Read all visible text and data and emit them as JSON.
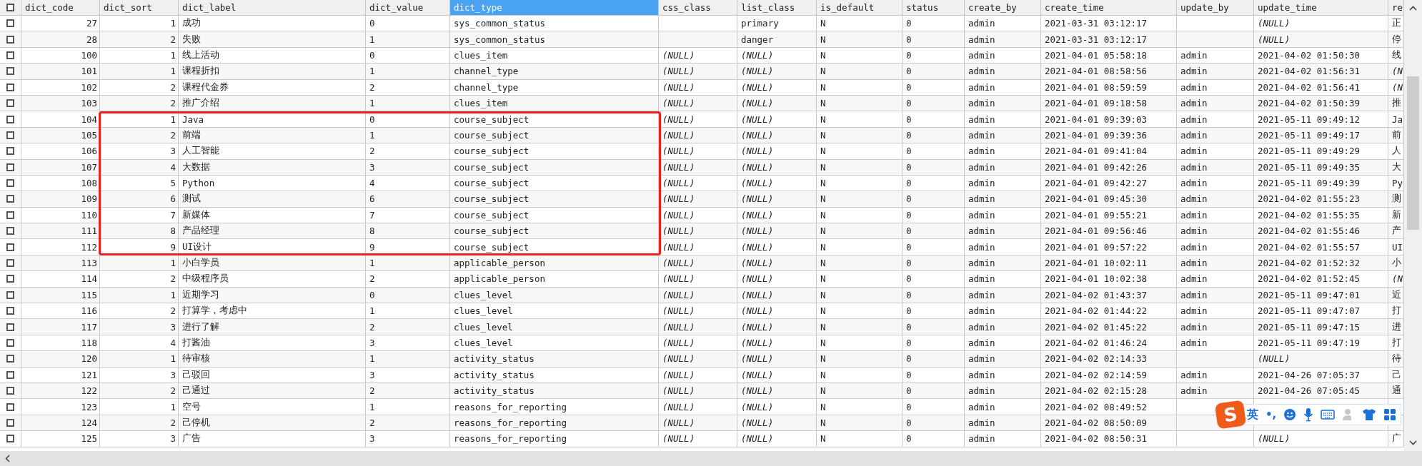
{
  "header_checkbox": {
    "checked": false
  },
  "columns": [
    {
      "label": "dict_code",
      "selected": false,
      "kind": "number"
    },
    {
      "label": "dict_sort",
      "selected": false,
      "kind": "number"
    },
    {
      "label": "dict_label",
      "selected": false,
      "kind": "text"
    },
    {
      "label": "dict_value",
      "selected": false,
      "kind": "text"
    },
    {
      "label": "dict_type",
      "selected": true,
      "kind": "text"
    },
    {
      "label": "css_class",
      "selected": false,
      "kind": "text"
    },
    {
      "label": "list_class",
      "selected": false,
      "kind": "text"
    },
    {
      "label": "is_default",
      "selected": false,
      "kind": "text"
    },
    {
      "label": "status",
      "selected": false,
      "kind": "text"
    },
    {
      "label": "create_by",
      "selected": false,
      "kind": "text"
    },
    {
      "label": "create_time",
      "selected": false,
      "kind": "text"
    },
    {
      "label": "update_by",
      "selected": false,
      "kind": "text"
    },
    {
      "label": "update_time",
      "selected": false,
      "kind": "text"
    },
    {
      "label": "re",
      "selected": false,
      "kind": "text"
    }
  ],
  "rows": [
    {
      "checked": false,
      "boxed": false,
      "cells": [
        "27",
        "1",
        "成功",
        "0",
        "sys_common_status",
        null,
        "primary",
        "N",
        "0",
        "admin",
        "2021-03-31 03:12:17",
        null,
        {
          "text": "(NULL)",
          "kind": "null"
        },
        "正"
      ]
    },
    {
      "checked": false,
      "boxed": false,
      "cells": [
        "28",
        "2",
        "失败",
        "1",
        "sys_common_status",
        null,
        "danger",
        "N",
        "0",
        "admin",
        "2021-03-31 03:12:17",
        null,
        {
          "text": "(NULL)",
          "kind": "null"
        },
        "停"
      ]
    },
    {
      "checked": false,
      "boxed": false,
      "cells": [
        "100",
        "1",
        "线上活动",
        "0",
        "clues_item",
        {
          "text": "(NULL)",
          "kind": "null"
        },
        {
          "text": "(NULL)",
          "kind": "null"
        },
        "N",
        "0",
        "admin",
        "2021-04-01 05:58:18",
        "admin",
        "2021-04-02 01:50:30",
        "线"
      ]
    },
    {
      "checked": false,
      "boxed": false,
      "cells": [
        "101",
        "1",
        "课程折扣",
        "1",
        "channel_type",
        {
          "text": "(NULL)",
          "kind": "null"
        },
        {
          "text": "(NULL)",
          "kind": "null"
        },
        "N",
        "0",
        "admin",
        "2021-04-01 08:58:56",
        "admin",
        "2021-04-02 01:56:31",
        {
          "text": "(N",
          "kind": "null"
        }
      ]
    },
    {
      "checked": false,
      "boxed": false,
      "cells": [
        "102",
        "2",
        "课程代金券",
        "2",
        "channel_type",
        {
          "text": "(NULL)",
          "kind": "null"
        },
        {
          "text": "(NULL)",
          "kind": "null"
        },
        "N",
        "0",
        "admin",
        "2021-04-01 08:59:59",
        "admin",
        "2021-04-02 01:56:41",
        {
          "text": "(N",
          "kind": "null"
        }
      ]
    },
    {
      "checked": false,
      "boxed": false,
      "cells": [
        "103",
        "2",
        "推广介绍",
        "1",
        "clues_item",
        {
          "text": "(NULL)",
          "kind": "null"
        },
        {
          "text": "(NULL)",
          "kind": "null"
        },
        "N",
        "0",
        "admin",
        "2021-04-01 09:18:58",
        "admin",
        "2021-04-02 01:50:39",
        "推"
      ]
    },
    {
      "checked": false,
      "boxed": true,
      "cells": [
        "104",
        "1",
        "Java",
        "0",
        "course_subject",
        {
          "text": "(NULL)",
          "kind": "null"
        },
        {
          "text": "(NULL)",
          "kind": "null"
        },
        "N",
        "0",
        "admin",
        "2021-04-01 09:39:03",
        "admin",
        "2021-05-11 09:49:12",
        "Ja"
      ]
    },
    {
      "checked": false,
      "boxed": true,
      "cells": [
        "105",
        "2",
        "前端",
        "1",
        "course_subject",
        {
          "text": "(NULL)",
          "kind": "null"
        },
        {
          "text": "(NULL)",
          "kind": "null"
        },
        "N",
        "0",
        "admin",
        "2021-04-01 09:39:36",
        "admin",
        "2021-05-11 09:49:17",
        "前"
      ]
    },
    {
      "checked": false,
      "boxed": true,
      "cells": [
        "106",
        "3",
        "人工智能",
        "2",
        "course_subject",
        {
          "text": "(NULL)",
          "kind": "null"
        },
        {
          "text": "(NULL)",
          "kind": "null"
        },
        "N",
        "0",
        "admin",
        "2021-04-01 09:41:04",
        "admin",
        "2021-05-11 09:49:29",
        "人"
      ]
    },
    {
      "checked": false,
      "boxed": true,
      "cells": [
        "107",
        "4",
        "大数据",
        "3",
        "course_subject",
        {
          "text": "(NULL)",
          "kind": "null"
        },
        {
          "text": "(NULL)",
          "kind": "null"
        },
        "N",
        "0",
        "admin",
        "2021-04-01 09:42:26",
        "admin",
        "2021-05-11 09:49:35",
        "大"
      ]
    },
    {
      "checked": false,
      "boxed": true,
      "cells": [
        "108",
        "5",
        "Python",
        "4",
        "course_subject",
        {
          "text": "(NULL)",
          "kind": "null"
        },
        {
          "text": "(NULL)",
          "kind": "null"
        },
        "N",
        "0",
        "admin",
        "2021-04-01 09:42:27",
        "admin",
        "2021-05-11 09:49:39",
        "Py"
      ]
    },
    {
      "checked": false,
      "boxed": true,
      "cells": [
        "109",
        "6",
        "测试",
        "6",
        "course_subject",
        {
          "text": "(NULL)",
          "kind": "null"
        },
        {
          "text": "(NULL)",
          "kind": "null"
        },
        "N",
        "0",
        "admin",
        "2021-04-01 09:45:30",
        "admin",
        "2021-04-02 01:55:23",
        "测"
      ]
    },
    {
      "checked": false,
      "boxed": true,
      "cells": [
        "110",
        "7",
        "新媒体",
        "7",
        "course_subject",
        {
          "text": "(NULL)",
          "kind": "null"
        },
        {
          "text": "(NULL)",
          "kind": "null"
        },
        "N",
        "0",
        "admin",
        "2021-04-01 09:55:21",
        "admin",
        "2021-04-02 01:55:35",
        "新"
      ]
    },
    {
      "checked": false,
      "boxed": true,
      "cells": [
        "111",
        "8",
        "产品经理",
        "8",
        "course_subject",
        {
          "text": "(NULL)",
          "kind": "null"
        },
        {
          "text": "(NULL)",
          "kind": "null"
        },
        "N",
        "0",
        "admin",
        "2021-04-01 09:56:46",
        "admin",
        "2021-04-02 01:55:46",
        "产"
      ]
    },
    {
      "checked": false,
      "boxed": true,
      "cells": [
        "112",
        "9",
        "UI设计",
        "9",
        "course_subject",
        {
          "text": "(NULL)",
          "kind": "null"
        },
        {
          "text": "(NULL)",
          "kind": "null"
        },
        "N",
        "0",
        "admin",
        "2021-04-01 09:57:22",
        "admin",
        "2021-04-02 01:55:57",
        "UI"
      ]
    },
    {
      "checked": false,
      "boxed": false,
      "cells": [
        "113",
        "1",
        "小白学员",
        "1",
        "applicable_person",
        {
          "text": "(NULL)",
          "kind": "null"
        },
        {
          "text": "(NULL)",
          "kind": "null"
        },
        "N",
        "0",
        "admin",
        "2021-04-01 10:02:11",
        "admin",
        "2021-04-02 01:52:32",
        "小"
      ]
    },
    {
      "checked": false,
      "boxed": false,
      "cells": [
        "114",
        "2",
        "中级程序员",
        "2",
        "applicable_person",
        {
          "text": "(NULL)",
          "kind": "null"
        },
        {
          "text": "(NULL)",
          "kind": "null"
        },
        "N",
        "0",
        "admin",
        "2021-04-01 10:02:38",
        "admin",
        "2021-04-02 01:52:45",
        {
          "text": "(N",
          "kind": "null"
        }
      ]
    },
    {
      "checked": false,
      "boxed": false,
      "cells": [
        "115",
        "1",
        "近期学习",
        "0",
        "clues_level",
        {
          "text": "(NULL)",
          "kind": "null"
        },
        {
          "text": "(NULL)",
          "kind": "null"
        },
        "N",
        "0",
        "admin",
        "2021-04-02 01:43:37",
        "admin",
        "2021-05-11 09:47:01",
        "近"
      ]
    },
    {
      "checked": false,
      "boxed": false,
      "cells": [
        "116",
        "2",
        "打算学，考虑中",
        "1",
        "clues_level",
        {
          "text": "(NULL)",
          "kind": "null"
        },
        {
          "text": "(NULL)",
          "kind": "null"
        },
        "N",
        "0",
        "admin",
        "2021-04-02 01:44:22",
        "admin",
        "2021-05-11 09:47:07",
        "打"
      ]
    },
    {
      "checked": false,
      "boxed": false,
      "cells": [
        "117",
        "3",
        "进行了解",
        "2",
        "clues_level",
        {
          "text": "(NULL)",
          "kind": "null"
        },
        {
          "text": "(NULL)",
          "kind": "null"
        },
        "N",
        "0",
        "admin",
        "2021-04-02 01:45:22",
        "admin",
        "2021-05-11 09:47:15",
        "进"
      ]
    },
    {
      "checked": false,
      "boxed": false,
      "cells": [
        "118",
        "4",
        "打酱油",
        "3",
        "clues_level",
        {
          "text": "(NULL)",
          "kind": "null"
        },
        {
          "text": "(NULL)",
          "kind": "null"
        },
        "N",
        "0",
        "admin",
        "2021-04-02 01:46:24",
        "admin",
        "2021-05-11 09:47:19",
        "打"
      ]
    },
    {
      "checked": false,
      "boxed": false,
      "cells": [
        "120",
        "1",
        "待审核",
        "1",
        "activity_status",
        {
          "text": "(NULL)",
          "kind": "null"
        },
        {
          "text": "(NULL)",
          "kind": "null"
        },
        "N",
        "0",
        "admin",
        "2021-04-02 02:14:33",
        null,
        {
          "text": "(NULL)",
          "kind": "null"
        },
        "待"
      ]
    },
    {
      "checked": false,
      "boxed": false,
      "cells": [
        "121",
        "3",
        "己驳回",
        "3",
        "activity_status",
        {
          "text": "(NULL)",
          "kind": "null"
        },
        {
          "text": "(NULL)",
          "kind": "null"
        },
        "N",
        "0",
        "admin",
        "2021-04-02 02:14:59",
        "admin",
        "2021-04-26 07:05:37",
        "己"
      ]
    },
    {
      "checked": false,
      "boxed": false,
      "cells": [
        "122",
        "2",
        "己通过",
        "2",
        "activity_status",
        {
          "text": "(NULL)",
          "kind": "null"
        },
        {
          "text": "(NULL)",
          "kind": "null"
        },
        "N",
        "0",
        "admin",
        "2021-04-02 02:15:28",
        "admin",
        "2021-04-26 07:05:45",
        "通"
      ]
    },
    {
      "checked": false,
      "boxed": false,
      "cells": [
        "123",
        "1",
        "空号",
        "1",
        "reasons_for_reporting",
        {
          "text": "(NULL)",
          "kind": "null"
        },
        {
          "text": "(NULL)",
          "kind": "null"
        },
        "N",
        "0",
        "admin",
        "2021-04-02 08:49:52",
        null,
        null,
        null
      ]
    },
    {
      "checked": false,
      "boxed": false,
      "cells": [
        "124",
        "2",
        "己停机",
        "2",
        "reasons_for_reporting",
        {
          "text": "(NULL)",
          "kind": "null"
        },
        {
          "text": "(NULL)",
          "kind": "null"
        },
        "N",
        "0",
        "admin",
        "2021-04-02 08:50:09",
        null,
        null,
        null
      ]
    },
    {
      "checked": false,
      "boxed": false,
      "cells": [
        "125",
        "3",
        "广告",
        "3",
        "reasons_for_reporting",
        {
          "text": "(NULL)",
          "kind": "null"
        },
        {
          "text": "(NULL)",
          "kind": "null"
        },
        "N",
        "0",
        "admin",
        "2021-04-02 08:50:31",
        null,
        {
          "text": "(NULL)",
          "kind": "null"
        },
        "广"
      ]
    }
  ],
  "ime_toolbar": {
    "logo": "S",
    "mode": "英",
    "punctuation": "•,"
  }
}
